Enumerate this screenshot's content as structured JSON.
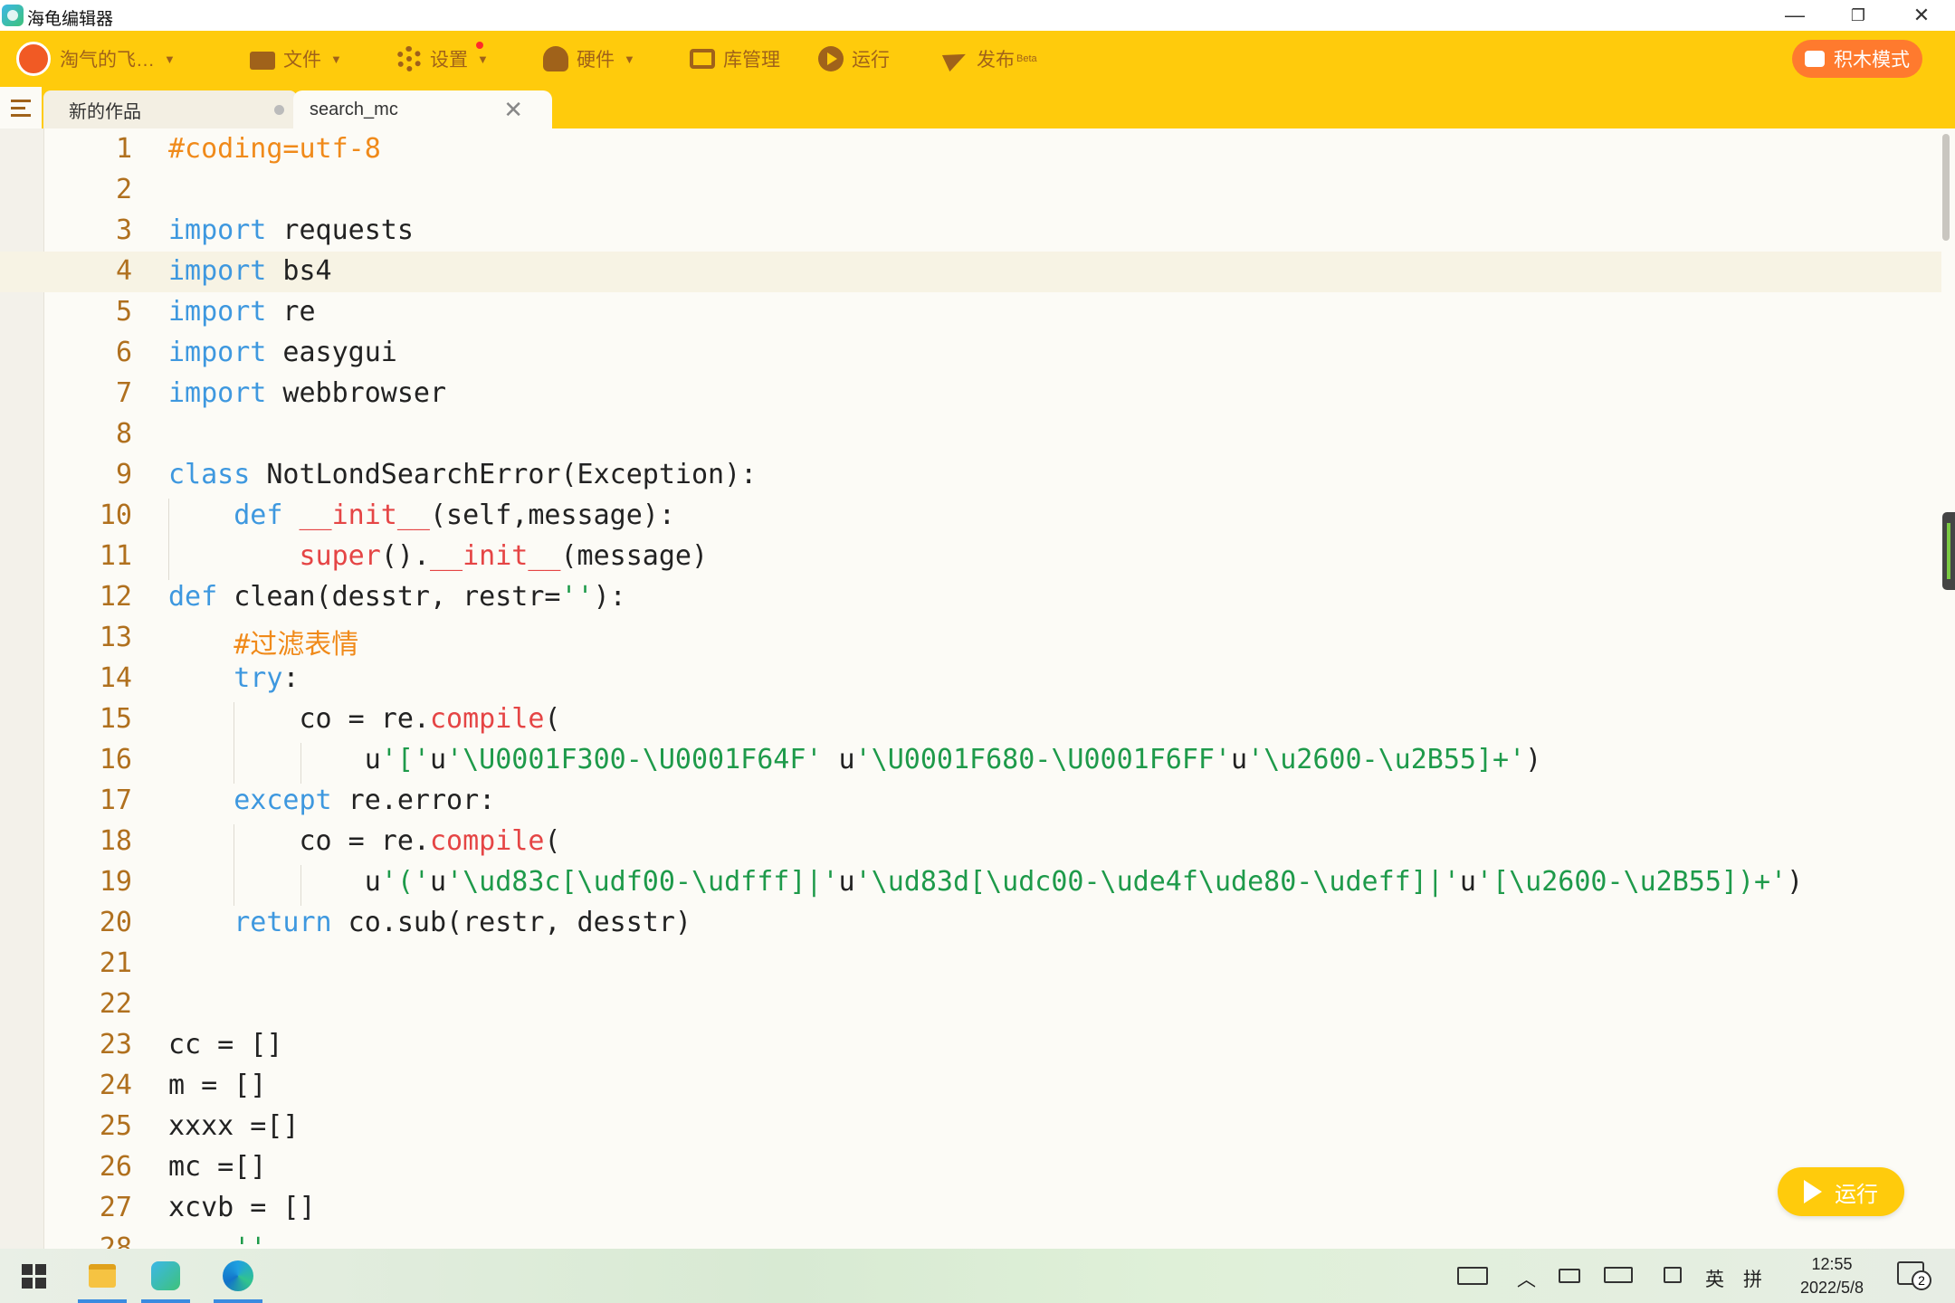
{
  "window": {
    "title": "海龟编辑器",
    "minimize": "—",
    "restore": "❐",
    "close": "✕"
  },
  "toolbar": {
    "user_name": "淘气的飞…",
    "file": "文件",
    "settings": "设置",
    "hardware": "硬件",
    "library": "库管理",
    "run": "运行",
    "publish": "发布",
    "publish_badge": "Beta",
    "block_mode": "积木模式"
  },
  "tabs": [
    {
      "label": "新的作品"
    },
    {
      "label": "search_mc",
      "close": "✕"
    }
  ],
  "editor": {
    "active_line": 4,
    "lines": [
      [
        [
          "#coding=utf-8",
          "comment"
        ]
      ],
      [],
      [
        [
          "import",
          "kw"
        ],
        [
          " requests",
          "plain"
        ]
      ],
      [
        [
          "import",
          "kw"
        ],
        [
          " bs4",
          "plain"
        ]
      ],
      [
        [
          "import",
          "kw"
        ],
        [
          " re",
          "plain"
        ]
      ],
      [
        [
          "import",
          "kw"
        ],
        [
          " easygui",
          "plain"
        ]
      ],
      [
        [
          "import",
          "kw"
        ],
        [
          " webbrowser",
          "plain"
        ]
      ],
      [],
      [
        [
          "class",
          "kw"
        ],
        [
          " NotLondSearchError(Exception):",
          "plain"
        ]
      ],
      [
        [
          "    ",
          "plain"
        ],
        [
          "def",
          "kw"
        ],
        [
          " ",
          "plain"
        ],
        [
          "__init__",
          "builtin"
        ],
        [
          "(self,message):",
          "plain"
        ]
      ],
      [
        [
          "        ",
          "plain"
        ],
        [
          "super",
          "builtin"
        ],
        [
          "().",
          "plain"
        ],
        [
          "__init__",
          "builtin"
        ],
        [
          "(message)",
          "plain"
        ]
      ],
      [
        [
          "def",
          "kw"
        ],
        [
          " clean(desstr, restr=",
          "plain"
        ],
        [
          "''",
          "str"
        ],
        [
          "):",
          "plain"
        ]
      ],
      [
        [
          "    ",
          "plain"
        ],
        [
          "#过滤表情",
          "comment"
        ]
      ],
      [
        [
          "    ",
          "plain"
        ],
        [
          "try",
          "kw"
        ],
        [
          ":",
          "plain"
        ]
      ],
      [
        [
          "        co = re.",
          "plain"
        ],
        [
          "compile",
          "builtin"
        ],
        [
          "(",
          "plain"
        ]
      ],
      [
        [
          "            u",
          "plain"
        ],
        [
          "'['",
          "str"
        ],
        [
          "u",
          "plain"
        ],
        [
          "'\\U0001F300-\\U0001F64F'",
          "str"
        ],
        [
          " u",
          "plain"
        ],
        [
          "'\\U0001F680-\\U0001F6FF'",
          "str"
        ],
        [
          "u",
          "plain"
        ],
        [
          "'\\u2600-\\u2B55]+'",
          "str"
        ],
        [
          ")",
          "plain"
        ]
      ],
      [
        [
          "    ",
          "plain"
        ],
        [
          "except",
          "kw"
        ],
        [
          " re.error:",
          "plain"
        ]
      ],
      [
        [
          "        co = re.",
          "plain"
        ],
        [
          "compile",
          "builtin"
        ],
        [
          "(",
          "plain"
        ]
      ],
      [
        [
          "            u",
          "plain"
        ],
        [
          "'('",
          "str"
        ],
        [
          "u",
          "plain"
        ],
        [
          "'\\ud83c[\\udf00-\\udfff]|'",
          "str"
        ],
        [
          "u",
          "plain"
        ],
        [
          "'\\ud83d[\\udc00-\\ude4f\\ude80-\\udeff]|'",
          "str"
        ],
        [
          "u",
          "plain"
        ],
        [
          "'[\\u2600-\\u2B55])+'",
          "str"
        ],
        [
          ")",
          "plain"
        ]
      ],
      [
        [
          "    ",
          "plain"
        ],
        [
          "return",
          "kw"
        ],
        [
          " co.sub(restr, desstr)",
          "plain"
        ]
      ],
      [],
      [],
      [
        [
          "cc = []",
          "plain"
        ]
      ],
      [
        [
          "m = []",
          "plain"
        ]
      ],
      [
        [
          "xxxx =[]",
          "plain"
        ]
      ],
      [
        [
          "mc =[]",
          "plain"
        ]
      ],
      [
        [
          "xcvb = []",
          "plain"
        ]
      ],
      [
        [
          "    ''",
          "str"
        ]
      ]
    ]
  },
  "run_button": "运行",
  "taskbar": {
    "ime_lang": "英",
    "ime_mode": "拼",
    "time": "12:55",
    "date": "2022/5/8",
    "notifications": "2"
  },
  "colors": {
    "toolbar": "#ffcb0c",
    "toolbar_text": "#a0621a",
    "keyword": "#3e98df",
    "builtin": "#e54545",
    "string": "#1e9a4a",
    "comment": "#f08a1a",
    "line_number": "#b0701e"
  }
}
